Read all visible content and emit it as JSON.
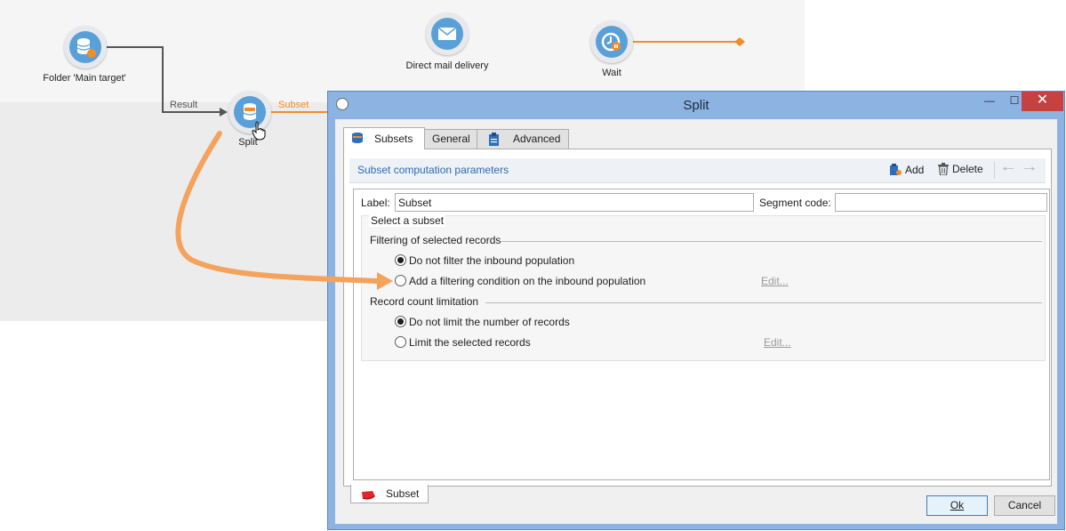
{
  "workflow": {
    "nodes": {
      "folder": {
        "label": "Folder 'Main target'",
        "icon": "database-target-icon"
      },
      "split": {
        "label": "Split",
        "icon": "split-database-icon"
      },
      "direct_mail": {
        "label": "Direct mail delivery",
        "icon": "envelope-icon"
      },
      "wait": {
        "label": "Wait",
        "icon": "clock-pause-icon"
      }
    },
    "links": {
      "result": "Result",
      "subset": "Subset"
    },
    "colors": {
      "accent_orange": "#f28c28",
      "node_blue": "#5aa0d8",
      "link_gray": "#555555"
    }
  },
  "dialog": {
    "title": "Split",
    "window_buttons": {
      "minimize": "—",
      "maximize": "☐",
      "close": "✕"
    },
    "tabs": [
      {
        "label": "Subsets",
        "icon": "database-icon"
      },
      {
        "label": "General"
      },
      {
        "label": "Advanced",
        "icon": "clipboard-icon"
      }
    ],
    "toolbar": {
      "title": "Subset computation parameters",
      "add": "Add",
      "delete": "Delete"
    },
    "form": {
      "label_caption": "Label:",
      "label_value": "Subset",
      "segment_code_caption": "Segment code:",
      "segment_code_value": "",
      "select_subset": "Select a subset",
      "filtering": {
        "title": "Filtering of selected records",
        "option_none": "Do not filter the inbound population",
        "option_condition": "Add a filtering condition on the inbound population",
        "edit": "Edit...",
        "selected": "none"
      },
      "limitation": {
        "title": "Record count limitation",
        "option_none": "Do not limit the number of records",
        "option_limit": "Limit the selected records",
        "edit": "Edit...",
        "selected": "none"
      }
    },
    "bottom_tab": "Subset",
    "buttons": {
      "ok": "Ok",
      "cancel": "Cancel"
    }
  }
}
